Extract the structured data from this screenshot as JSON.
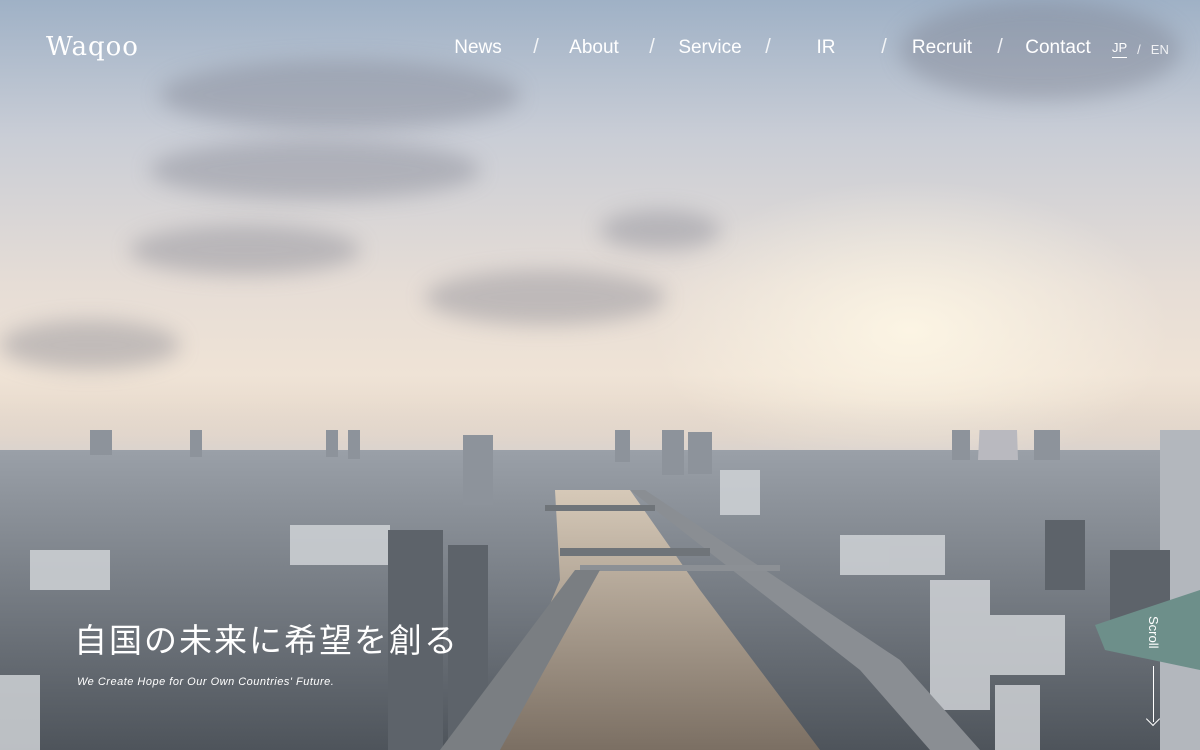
{
  "brand": {
    "logo": "Waqoo"
  },
  "nav": {
    "items": [
      {
        "label": "News"
      },
      {
        "label": "About"
      },
      {
        "label": "Service"
      },
      {
        "label": "IR"
      },
      {
        "label": "Recruit"
      },
      {
        "label": "Contact"
      }
    ],
    "separator": "/"
  },
  "language": {
    "jp": "JP",
    "en": "EN",
    "separator": "/",
    "active": "JP"
  },
  "hero": {
    "headline": "自国の未来に希望を創る",
    "tagline": "We Create Hope for Our Own Countries' Future."
  },
  "scroll": {
    "label": "Scroll",
    "icon": "arrow-down-icon"
  }
}
